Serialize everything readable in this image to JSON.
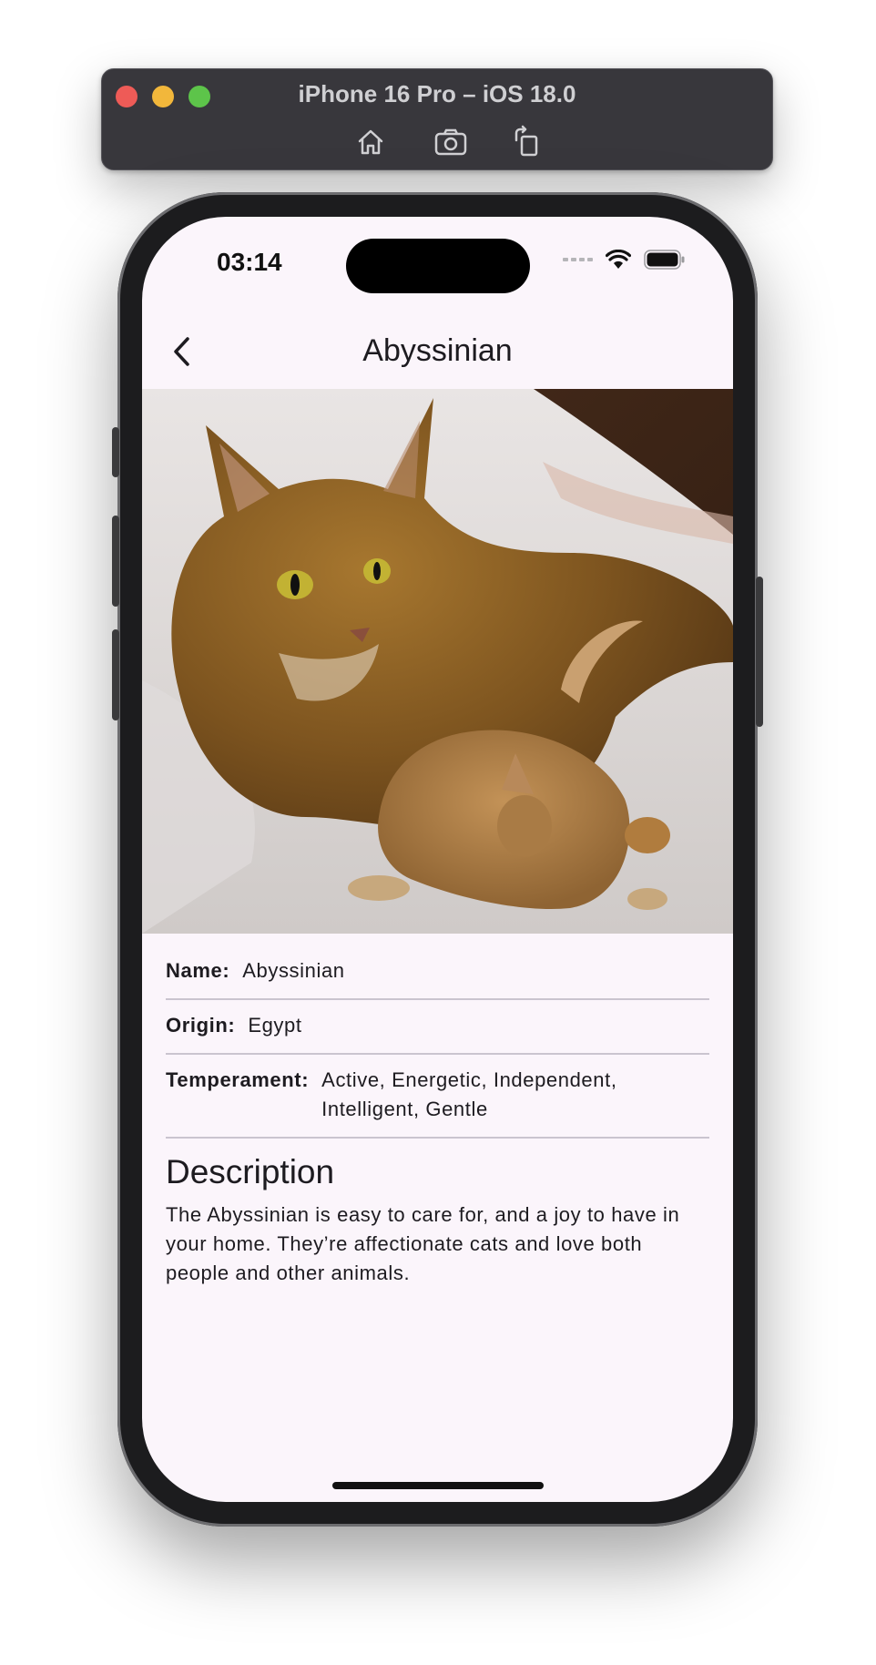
{
  "simulator": {
    "title": "iPhone 16 Pro – iOS 18.0",
    "buttons": [
      "home-icon",
      "screenshot-icon",
      "rotate-icon"
    ]
  },
  "status_bar": {
    "time": "03:14",
    "icons": [
      "cellular-dots-icon",
      "wifi-icon",
      "battery-icon"
    ]
  },
  "navbar": {
    "title": "Abyssinian",
    "back_icon": "chevron-left-icon"
  },
  "hero_image": {
    "subject": "Abyssinian cat with kitten"
  },
  "details": {
    "rows": [
      {
        "label": "Name:",
        "value": "Abyssinian"
      },
      {
        "label": "Origin:",
        "value": "Egypt"
      },
      {
        "label": "Temperament:",
        "value": "Active, Energetic, Independent, Intelligent, Gentle"
      }
    ]
  },
  "description": {
    "heading": "Description",
    "text": "The Abyssinian is easy to care for, and a joy to have in your home. They’re affectionate cats and love both people and other animals."
  },
  "colors": {
    "background": "#fbf5fb",
    "text": "#1d1b20",
    "divider": "#cac4cf"
  }
}
